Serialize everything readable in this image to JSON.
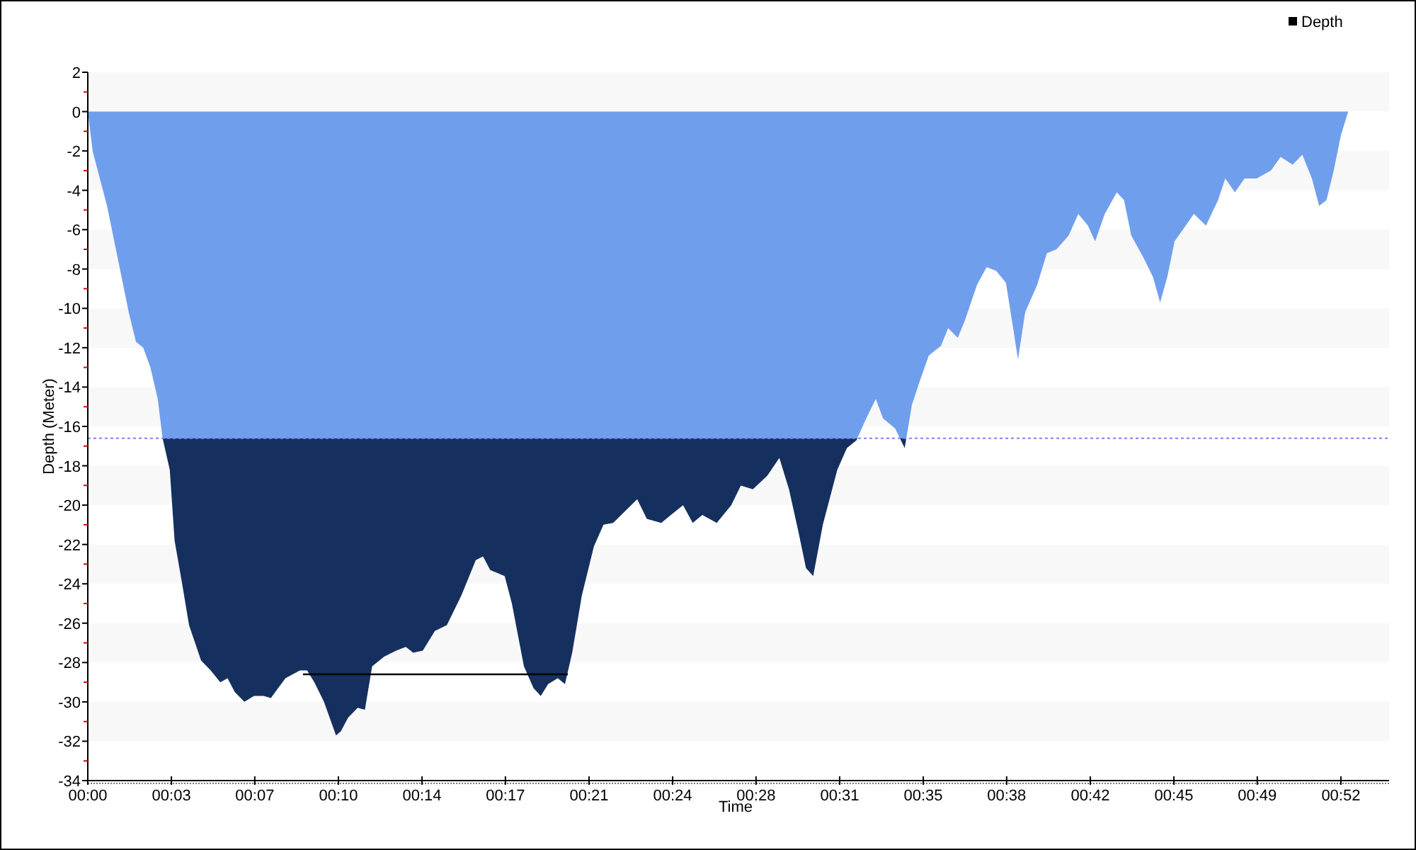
{
  "depth_chart": {
    "chart_data": {
      "type": "area",
      "xlabel": "Time",
      "ylabel": "Depth (Meter)",
      "xlim": [
        0,
        54
      ],
      "ylim": [
        -34,
        2
      ],
      "xticks": [
        {
          "value": 0,
          "label": "00:00"
        },
        {
          "value": 3.47,
          "label": "00:03"
        },
        {
          "value": 6.93,
          "label": "00:07"
        },
        {
          "value": 10.4,
          "label": "00:10"
        },
        {
          "value": 13.87,
          "label": "00:14"
        },
        {
          "value": 17.33,
          "label": "00:17"
        },
        {
          "value": 20.8,
          "label": "00:21"
        },
        {
          "value": 24.27,
          "label": "00:24"
        },
        {
          "value": 27.73,
          "label": "00:28"
        },
        {
          "value": 31.2,
          "label": "00:31"
        },
        {
          "value": 34.67,
          "label": "00:35"
        },
        {
          "value": 38.13,
          "label": "00:38"
        },
        {
          "value": 41.6,
          "label": "00:42"
        },
        {
          "value": 45.07,
          "label": "00:45"
        },
        {
          "value": 48.53,
          "label": "00:49"
        },
        {
          "value": 52,
          "label": "00:52"
        }
      ],
      "yticks": [
        2,
        0,
        -2,
        -4,
        -6,
        -8,
        -10,
        -12,
        -14,
        -16,
        -18,
        -20,
        -22,
        -24,
        -26,
        -28,
        -30,
        -32,
        -34
      ],
      "x": [
        0,
        0.2,
        0.5,
        0.8,
        1.1,
        1.4,
        1.7,
        2.0,
        2.3,
        2.6,
        2.9,
        3.1,
        3.4,
        3.6,
        3.9,
        4.2,
        4.7,
        5.1,
        5.5,
        5.8,
        6.1,
        6.5,
        6.9,
        7.3,
        7.6,
        7.9,
        8.2,
        8.8,
        9.1,
        9.4,
        9.8,
        10.3,
        10.5,
        10.8,
        11.2,
        11.5,
        11.8,
        12.3,
        12.8,
        13.2,
        13.5,
        13.9,
        14.4,
        14.9,
        15.5,
        16.1,
        16.4,
        16.7,
        17.3,
        17.6,
        18.1,
        18.5,
        18.8,
        19.1,
        19.5,
        19.8,
        20.1,
        20.5,
        21.0,
        21.4,
        21.8,
        22.3,
        22.8,
        23.2,
        23.8,
        24.2,
        24.7,
        25.1,
        25.5,
        26.1,
        26.7,
        27.1,
        27.6,
        28.2,
        28.7,
        29.1,
        29.5,
        29.8,
        30.1,
        30.5,
        31.1,
        31.5,
        31.9,
        32.3,
        32.7,
        33.0,
        33.5,
        33.9,
        34.2,
        34.5,
        34.9,
        35.4,
        35.7,
        36.1,
        36.4,
        36.9,
        37.3,
        37.7,
        38.1,
        38.4,
        38.6,
        38.9,
        39.4,
        39.8,
        40.2,
        40.7,
        41.1,
        41.5,
        41.8,
        42.2,
        42.7,
        43.0,
        43.3,
        43.8,
        44.2,
        44.5,
        44.8,
        45.1,
        45.5,
        45.9,
        46.4,
        46.9,
        47.2,
        47.6,
        48.0,
        48.5,
        49.1,
        49.5,
        50.0,
        50.4,
        50.8,
        51.1,
        51.4,
        51.7,
        52.0,
        52.3
      ],
      "series": [
        {
          "name": "Depth",
          "color": "#6f9fec",
          "values": [
            0,
            -2.0,
            -3.4,
            -4.8,
            -6.6,
            -8.4,
            -10.2,
            -11.7,
            -12.0,
            -13.0,
            -14.6,
            -16.6,
            -18.2,
            -21.8,
            -23.9,
            -26.1,
            -27.9,
            -28.4,
            -29.0,
            -28.8,
            -29.5,
            -30.0,
            -29.7,
            -29.7,
            -29.8,
            -29.3,
            -28.8,
            -28.4,
            -28.4,
            -29.0,
            -30.0,
            -31.7,
            -31.5,
            -30.8,
            -30.3,
            -30.4,
            -28.2,
            -27.7,
            -27.4,
            -27.2,
            -27.5,
            -27.4,
            -26.4,
            -26.1,
            -24.6,
            -22.8,
            -22.6,
            -23.3,
            -23.6,
            -25.0,
            -28.2,
            -29.3,
            -29.7,
            -29.1,
            -28.8,
            -29.1,
            -27.5,
            -24.6,
            -22.1,
            -21.0,
            -20.9,
            -20.3,
            -19.7,
            -20.7,
            -20.9,
            -20.5,
            -20.0,
            -20.9,
            -20.5,
            -20.9,
            -20.0,
            -19.0,
            -19.2,
            -18.5,
            -17.6,
            -19.2,
            -21.4,
            -23.2,
            -23.6,
            -21.0,
            -18.2,
            -17.1,
            -16.7,
            -15.6,
            -14.6,
            -15.6,
            -16.1,
            -17.1,
            -14.9,
            -13.8,
            -12.4,
            -11.9,
            -11.0,
            -11.5,
            -10.6,
            -8.8,
            -7.9,
            -8.1,
            -8.7,
            -11.0,
            -12.6,
            -10.2,
            -8.8,
            -7.2,
            -7.0,
            -6.3,
            -5.2,
            -5.8,
            -6.6,
            -5.2,
            -4.1,
            -4.5,
            -6.3,
            -7.4,
            -8.4,
            -9.7,
            -8.4,
            -6.6,
            -5.9,
            -5.2,
            -5.8,
            -4.5,
            -3.4,
            -4.1,
            -3.4,
            -3.4,
            -3.0,
            -2.3,
            -2.7,
            -2.2,
            -3.4,
            -4.8,
            -4.5,
            -3.0,
            -1.2,
            0
          ]
        }
      ],
      "ref_lines": [
        {
          "axis": "y",
          "value": -16.6,
          "color": "#8080ff"
        }
      ]
    }
  }
}
